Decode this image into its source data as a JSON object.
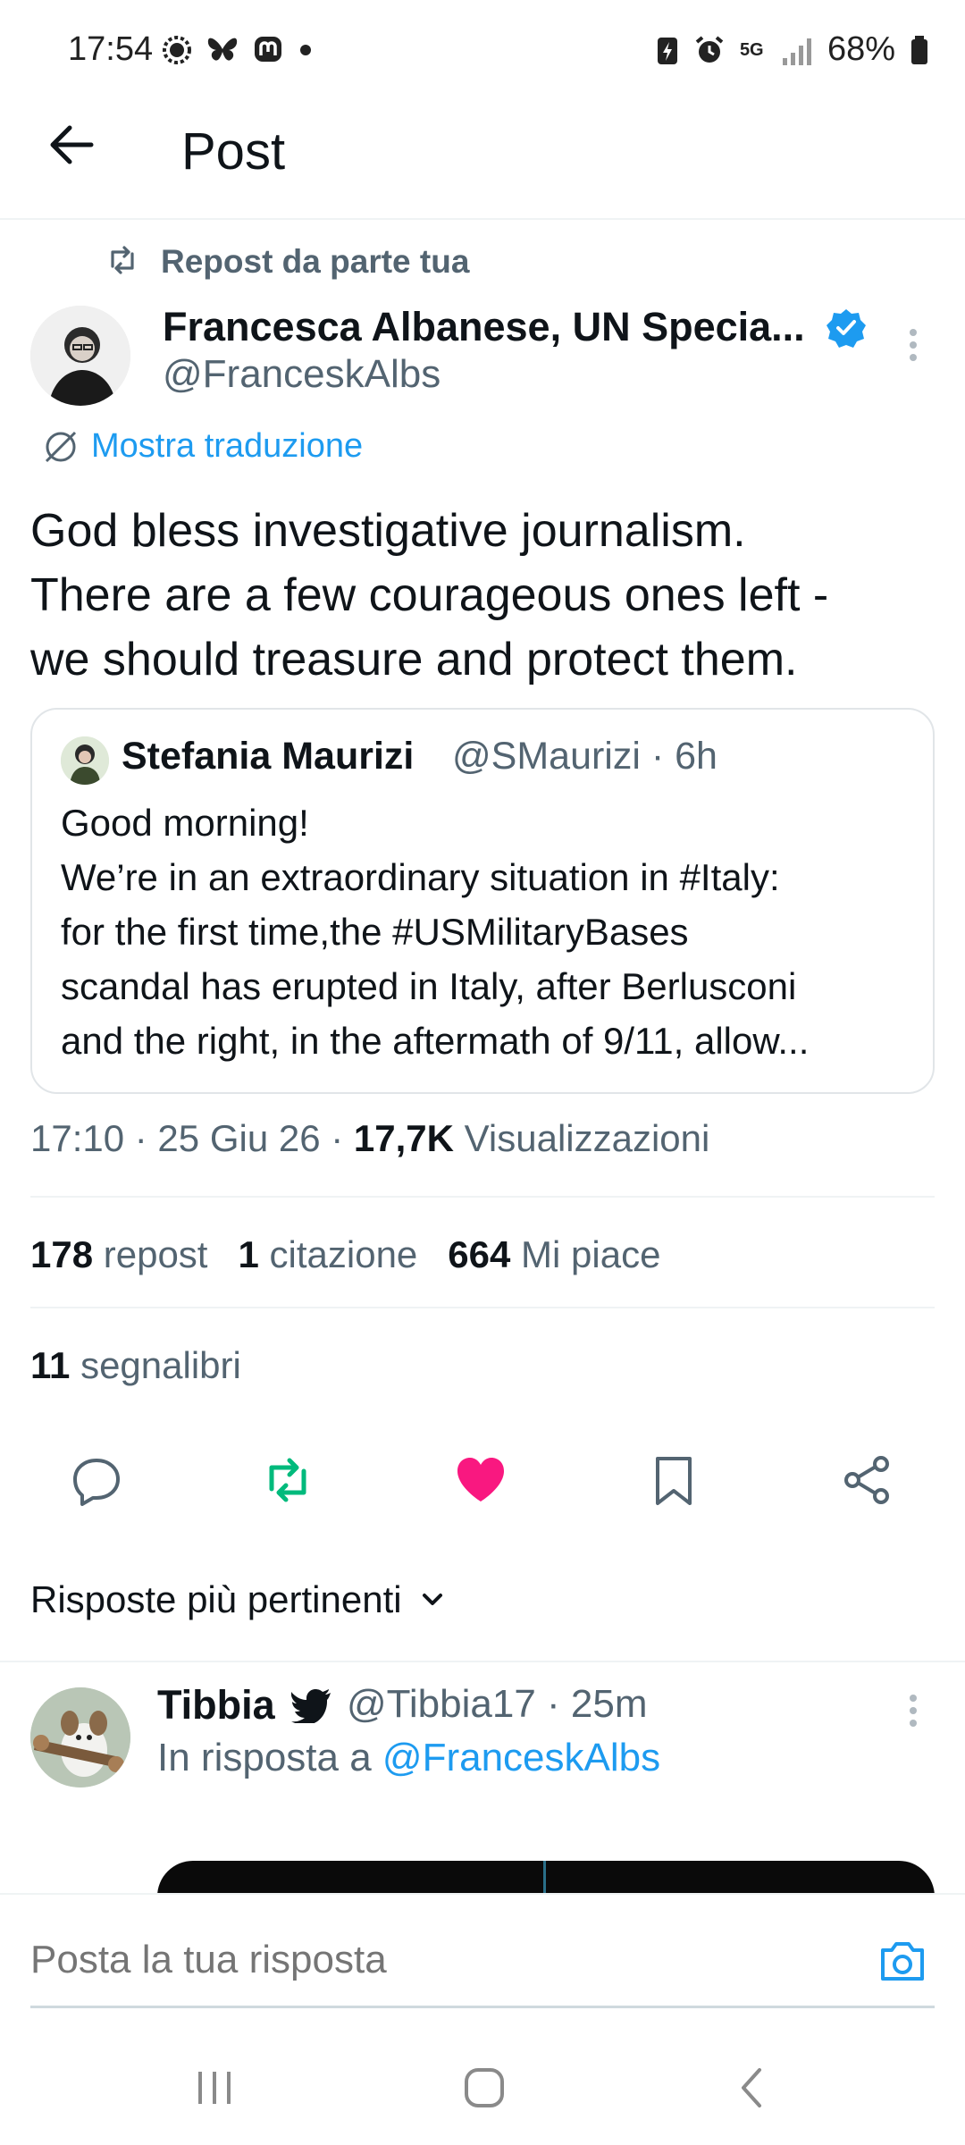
{
  "status_bar": {
    "time": "17:54",
    "network": "5G",
    "battery": "68%",
    "icons": [
      "signal-app-icon",
      "bluesky-icon",
      "mastodon-icon",
      "dot-icon",
      "battery-saver-icon",
      "alarm-icon",
      "network-5g-icon",
      "signal-bars-icon",
      "battery-icon"
    ]
  },
  "header": {
    "title": "Post",
    "back_icon": "arrow-left-icon"
  },
  "post": {
    "repost_label": "Repost da parte tua",
    "author_name": "Francesca Albanese, UN Specia...",
    "author_handle": "@FranceskAlbs",
    "translate_label": "Mostra traduzione",
    "text_lines": [
      "God bless investigative journalism.",
      "There are a few courageous ones left -",
      "we should treasure and protect them."
    ],
    "quote": {
      "name": "Stefania Maurizi",
      "handle_time": "@SMaurizi · 6h",
      "lines": [
        "Good morning!",
        "We’re in an extraordinary situation in #Italy:",
        "for the first time,the #USMilitaryBases",
        "scandal has erupted in Italy, after Berlusconi",
        "and the right, in the aftermath of 9/11, allow..."
      ]
    },
    "meta": {
      "time_date": "17:10 · 25 Giu 26 · ",
      "views_count": "17,7K",
      "views_label": " Visualizzazioni"
    },
    "stats": [
      {
        "num": "178",
        "label": "repost"
      },
      {
        "num": "1",
        "label": "citazione"
      },
      {
        "num": "664",
        "label": "Mi piace"
      }
    ],
    "bookmarks": {
      "num": "11",
      "label": "segnalibri"
    },
    "colors": {
      "repost": "#00ba7c",
      "like": "#f91880",
      "link": "#1d9bf0"
    }
  },
  "replies": {
    "header": "Risposte più pertinenti",
    "items": [
      {
        "name": "Tibbia",
        "handle_time": "@Tibbia17 · 25m",
        "reply_prefix": "In risposta a ",
        "reply_handle": "@FranceskAlbs"
      }
    ]
  },
  "composer": {
    "placeholder": "Posta la tua risposta"
  },
  "navbar": {
    "buttons": [
      "recents-icon",
      "home-icon",
      "back-icon"
    ]
  }
}
